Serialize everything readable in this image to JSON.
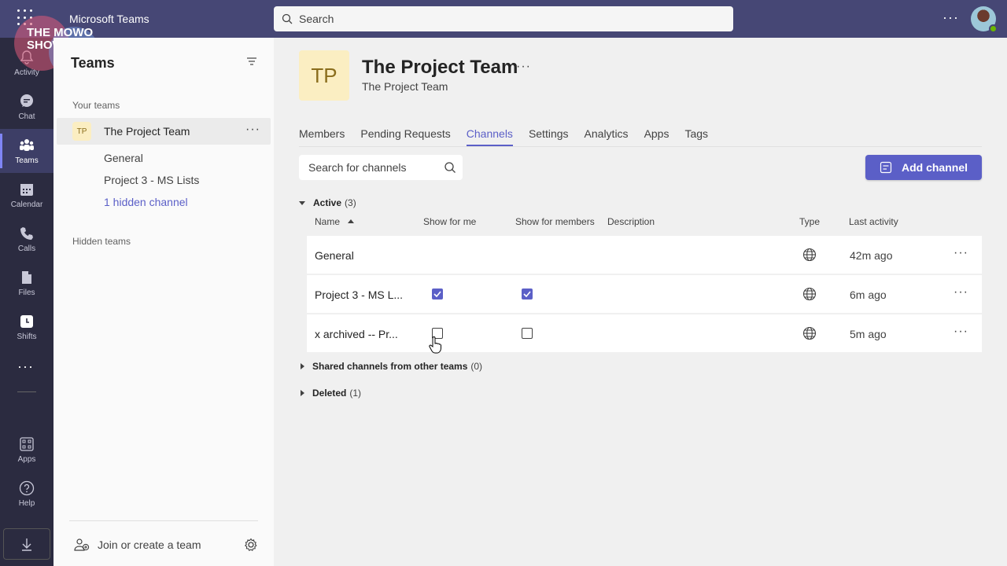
{
  "app": {
    "title": "Microsoft Teams"
  },
  "search": {
    "placeholder": "Search"
  },
  "logo": {
    "text": "THE MOWO SHOW"
  },
  "rail": {
    "items": [
      {
        "label": "Activity"
      },
      {
        "label": "Chat"
      },
      {
        "label": "Teams"
      },
      {
        "label": "Calendar"
      },
      {
        "label": "Calls"
      },
      {
        "label": "Files"
      },
      {
        "label": "Shifts"
      }
    ],
    "more": "···",
    "apps": "Apps",
    "help": "Help"
  },
  "teams_pane": {
    "title": "Teams",
    "your_teams_label": "Your teams",
    "team": {
      "initials": "TP",
      "name": "The Project Team"
    },
    "channels": [
      "General",
      "Project 3 - MS Lists"
    ],
    "hidden_channel_link": "1 hidden channel",
    "hidden_teams_label": "Hidden teams",
    "join_create": "Join or create a team"
  },
  "team_header": {
    "initials": "TP",
    "name": "The Project Team",
    "subtitle": "The Project Team"
  },
  "tabs": [
    "Members",
    "Pending Requests",
    "Channels",
    "Settings",
    "Analytics",
    "Apps",
    "Tags"
  ],
  "active_tab": "Channels",
  "channel_search": {
    "placeholder": "Search for channels"
  },
  "add_channel_label": "Add channel",
  "groups": {
    "active": {
      "label": "Active",
      "count": "(3)"
    },
    "shared": {
      "label": "Shared channels from other teams",
      "count": "(0)"
    },
    "deleted": {
      "label": "Deleted",
      "count": "(1)"
    }
  },
  "columns": {
    "name": "Name",
    "show_for_me": "Show for me",
    "show_for_members": "Show for members",
    "description": "Description",
    "type": "Type",
    "last_activity": "Last activity"
  },
  "rows": [
    {
      "name": "General",
      "show_for_me": null,
      "show_for_members": null,
      "last_activity": "42m ago"
    },
    {
      "name": "Project 3 - MS L...",
      "show_for_me": true,
      "show_for_members": true,
      "last_activity": "6m ago"
    },
    {
      "name": "x archived -- Pr...",
      "show_for_me": false,
      "show_for_members": false,
      "last_activity": "5m ago"
    }
  ],
  "colors": {
    "accent": "#5b5fc7",
    "topbar": "#464775",
    "rail": "#2b2b40",
    "team_tile": "#fbeec2"
  }
}
